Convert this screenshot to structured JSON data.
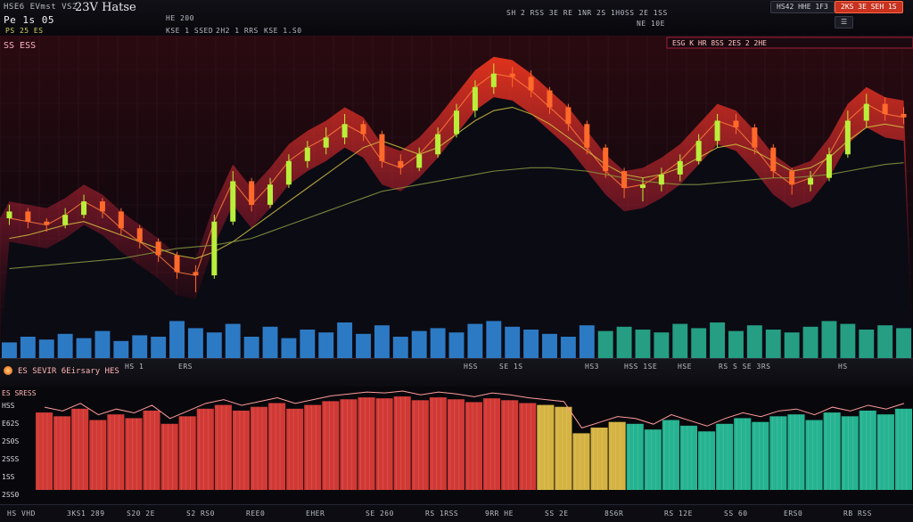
{
  "header": {
    "title": "23V Hatse",
    "left_tag": "HSE6 EVmst VS2",
    "left_sub": "Pe 1s 05",
    "left_small": "PS 25 ES",
    "ticker_items": [
      "HE 200",
      "KSE 1 SSED",
      "2H2 1 RRS",
      "KSE 1.S0"
    ],
    "center_info": "SH 2 RSS 3E RE 1NR 2S 1H0SS 2E 1SS",
    "center_sub": "NE 10E",
    "right_info": "HS42 HHE 1F3",
    "right_button": "2KS 3E SEH 1S",
    "panel_badge": "ESG K HR 8SS 2ES 2 2HE",
    "symbol": "SS ESS"
  },
  "divider": {
    "label": "ES SEVIR 6Eirsary HES",
    "items": [
      "HS 1",
      "ERS",
      "HSS",
      "SE 1S",
      "HS3",
      "HSS 1SE",
      "HSE",
      "RS S SE 3RS",
      "HS"
    ]
  },
  "volume_panel": {
    "label": "ES SRESS",
    "ylabels": [
      "HSS",
      "E62S",
      "2S0S",
      "2SSS",
      "1SS",
      "2SS0"
    ]
  },
  "bottom": {
    "items": [
      "HS VHD",
      "3KS1 289",
      "S20 2E",
      "S2 RS0",
      "REE0",
      "EHER",
      "SE 260",
      "RS 1RSS",
      "9RR HE",
      "SS 2E",
      "8S6R",
      "RS 12E",
      "SS 60",
      "ERS0",
      "RB RSS"
    ]
  },
  "colors": {
    "bull": "#b9ef3a",
    "bear": "#ff6a2a",
    "area_top": "#ff3a1e",
    "panel_red": "#e83f3a",
    "panel_yellow": "#ecc648",
    "panel_green": "#29c7a0",
    "vol_blue": "#3aa0ff"
  },
  "chart_data": {
    "type": "line",
    "series": [
      {
        "values": [
          62,
          60,
          58,
          64,
          72,
          66,
          56,
          48,
          40,
          30,
          28,
          60,
          84,
          70,
          82,
          96,
          104,
          110,
          118,
          112,
          96,
          92,
          100,
          112,
          126,
          140,
          148,
          146,
          138,
          128,
          118,
          104,
          90,
          80,
          82,
          88,
          96,
          108,
          120,
          116,
          104,
          90,
          82,
          86,
          100,
          120,
          130,
          124,
          122
        ]
      },
      {
        "values": [
          50,
          52,
          55,
          58,
          60,
          56,
          52,
          48,
          44,
          40,
          38,
          42,
          48,
          56,
          64,
          72,
          80,
          88,
          96,
          104,
          108,
          104,
          100,
          104,
          112,
          120,
          126,
          128,
          124,
          118,
          110,
          102,
          94,
          88,
          86,
          88,
          92,
          98,
          104,
          106,
          102,
          96,
          90,
          92,
          98,
          108,
          116,
          118,
          116
        ]
      },
      {
        "values": [
          32,
          33,
          34,
          35,
          36,
          37,
          38,
          40,
          42,
          44,
          45,
          46,
          48,
          50,
          54,
          58,
          62,
          66,
          70,
          74,
          78,
          80,
          82,
          84,
          86,
          88,
          90,
          91,
          92,
          92,
          91,
          90,
          88,
          86,
          84,
          83,
          82,
          82,
          83,
          84,
          85,
          86,
          86,
          87,
          88,
          90,
          92,
          94,
          95
        ]
      }
    ],
    "candles": [
      {
        "o": 62,
        "c": 66,
        "h": 70,
        "l": 58
      },
      {
        "o": 66,
        "c": 60,
        "h": 68,
        "l": 56
      },
      {
        "o": 60,
        "c": 58,
        "h": 62,
        "l": 54
      },
      {
        "o": 58,
        "c": 64,
        "h": 68,
        "l": 56
      },
      {
        "o": 64,
        "c": 72,
        "h": 76,
        "l": 62
      },
      {
        "o": 72,
        "c": 66,
        "h": 74,
        "l": 62
      },
      {
        "o": 66,
        "c": 56,
        "h": 68,
        "l": 52
      },
      {
        "o": 56,
        "c": 48,
        "h": 58,
        "l": 44
      },
      {
        "o": 48,
        "c": 40,
        "h": 50,
        "l": 36
      },
      {
        "o": 40,
        "c": 30,
        "h": 42,
        "l": 26
      },
      {
        "o": 30,
        "c": 28,
        "h": 34,
        "l": 18
      },
      {
        "o": 28,
        "c": 60,
        "h": 64,
        "l": 26
      },
      {
        "o": 60,
        "c": 84,
        "h": 90,
        "l": 58
      },
      {
        "o": 84,
        "c": 70,
        "h": 86,
        "l": 66
      },
      {
        "o": 70,
        "c": 82,
        "h": 86,
        "l": 68
      },
      {
        "o": 82,
        "c": 96,
        "h": 100,
        "l": 80
      },
      {
        "o": 96,
        "c": 104,
        "h": 108,
        "l": 92
      },
      {
        "o": 104,
        "c": 110,
        "h": 116,
        "l": 100
      },
      {
        "o": 110,
        "c": 118,
        "h": 124,
        "l": 106
      },
      {
        "o": 118,
        "c": 112,
        "h": 120,
        "l": 108
      },
      {
        "o": 112,
        "c": 96,
        "h": 114,
        "l": 92
      },
      {
        "o": 96,
        "c": 92,
        "h": 100,
        "l": 88
      },
      {
        "o": 92,
        "c": 100,
        "h": 104,
        "l": 90
      },
      {
        "o": 100,
        "c": 112,
        "h": 116,
        "l": 98
      },
      {
        "o": 112,
        "c": 126,
        "h": 130,
        "l": 110
      },
      {
        "o": 126,
        "c": 140,
        "h": 144,
        "l": 122
      },
      {
        "o": 140,
        "c": 148,
        "h": 154,
        "l": 136
      },
      {
        "o": 148,
        "c": 146,
        "h": 152,
        "l": 140
      },
      {
        "o": 146,
        "c": 138,
        "h": 150,
        "l": 134
      },
      {
        "o": 138,
        "c": 128,
        "h": 140,
        "l": 124
      },
      {
        "o": 128,
        "c": 118,
        "h": 130,
        "l": 114
      },
      {
        "o": 118,
        "c": 104,
        "h": 120,
        "l": 100
      },
      {
        "o": 104,
        "c": 90,
        "h": 106,
        "l": 86
      },
      {
        "o": 90,
        "c": 80,
        "h": 92,
        "l": 74
      },
      {
        "o": 80,
        "c": 82,
        "h": 86,
        "l": 72
      },
      {
        "o": 82,
        "c": 88,
        "h": 92,
        "l": 78
      },
      {
        "o": 88,
        "c": 96,
        "h": 100,
        "l": 84
      },
      {
        "o": 96,
        "c": 108,
        "h": 112,
        "l": 94
      },
      {
        "o": 108,
        "c": 120,
        "h": 124,
        "l": 104
      },
      {
        "o": 120,
        "c": 116,
        "h": 124,
        "l": 112
      },
      {
        "o": 116,
        "c": 104,
        "h": 118,
        "l": 100
      },
      {
        "o": 104,
        "c": 90,
        "h": 106,
        "l": 86
      },
      {
        "o": 90,
        "c": 82,
        "h": 92,
        "l": 76
      },
      {
        "o": 82,
        "c": 86,
        "h": 90,
        "l": 78
      },
      {
        "o": 86,
        "c": 100,
        "h": 104,
        "l": 84
      },
      {
        "o": 100,
        "c": 120,
        "h": 126,
        "l": 98
      },
      {
        "o": 120,
        "c": 130,
        "h": 136,
        "l": 116
      },
      {
        "o": 130,
        "c": 124,
        "h": 134,
        "l": 120
      },
      {
        "o": 124,
        "c": 122,
        "h": 128,
        "l": 118
      }
    ],
    "volume": [
      22,
      30,
      26,
      34,
      28,
      38,
      24,
      32,
      30,
      52,
      42,
      36,
      48,
      30,
      44,
      28,
      40,
      36,
      50,
      34,
      46,
      30,
      38,
      42,
      36,
      48,
      52,
      44,
      40,
      34,
      30,
      46,
      38,
      44,
      40,
      36,
      48,
      42,
      50,
      38,
      46,
      40,
      36,
      44,
      52,
      48,
      40,
      46,
      42
    ],
    "lower_panel": [
      0.82,
      0.78,
      0.86,
      0.74,
      0.8,
      0.76,
      0.84,
      0.7,
      0.78,
      0.86,
      0.9,
      0.84,
      0.88,
      0.92,
      0.86,
      0.9,
      0.94,
      0.96,
      0.98,
      0.97,
      0.99,
      0.95,
      0.98,
      0.96,
      0.93,
      0.97,
      0.95,
      0.92,
      0.9,
      0.88,
      0.6,
      0.66,
      0.72,
      0.7,
      0.64,
      0.74,
      0.68,
      0.62,
      0.7,
      0.76,
      0.72,
      0.78,
      0.8,
      0.74,
      0.82,
      0.78,
      0.84,
      0.8,
      0.86
    ],
    "ylim": [
      0,
      160
    ]
  }
}
